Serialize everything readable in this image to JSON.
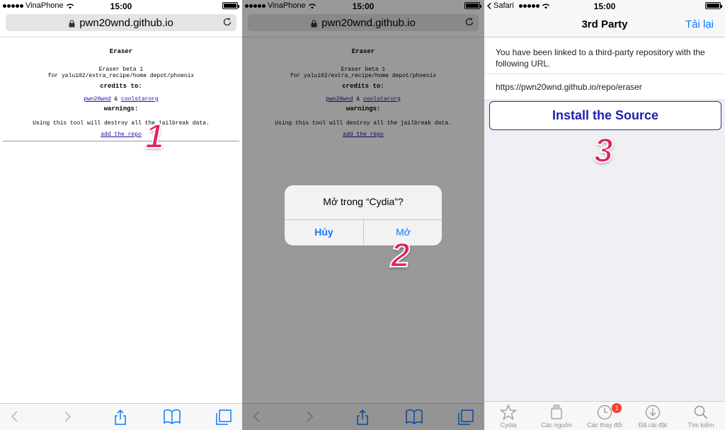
{
  "status": {
    "carrier": "VinaPhone",
    "time": "15:00",
    "back_app": "Safari"
  },
  "browser": {
    "url": "pwn20wnd.github.io"
  },
  "webpage": {
    "title": "Eraser",
    "subtitle_line1": "Eraser beta 1",
    "subtitle_line2": "for yalu102/extra_recipe/home depot/phoenix",
    "credits_heading": "credits to:",
    "credit_link1": "pwn20wnd",
    "credit_amp": "&",
    "credit_link2": "coolstarorg",
    "warnings_heading": "warnings:",
    "warning_text": "Using this tool will destroy all the jailbreak data.",
    "add_repo_link": "add the repo"
  },
  "dialog": {
    "title": "Mở trong “Cydia”?",
    "cancel_label": "Hủy",
    "open_label": "Mở"
  },
  "steps": {
    "one": "1",
    "two": "2",
    "three": "3"
  },
  "cydia": {
    "nav_title": "3rd Party",
    "reload_label": "Tải lại",
    "message": "You have been linked to a third-party repository with the following URL.",
    "repo_url": "https://pwn20wnd.github.io/repo/eraser",
    "install_label": "Install the Source",
    "tabs": [
      {
        "label": "Cydia",
        "icon": "star-icon"
      },
      {
        "label": "Các nguồn",
        "icon": "sources-icon"
      },
      {
        "label": "Các thay đổi",
        "icon": "clock-icon",
        "badge": "1"
      },
      {
        "label": "Đã cài đặt",
        "icon": "download-icon"
      },
      {
        "label": "Tìm kiếm",
        "icon": "search-icon"
      }
    ]
  },
  "colors": {
    "ios_blue": "#0a7aff",
    "step_number": "#e0245e",
    "install_text": "#1f1fae"
  }
}
